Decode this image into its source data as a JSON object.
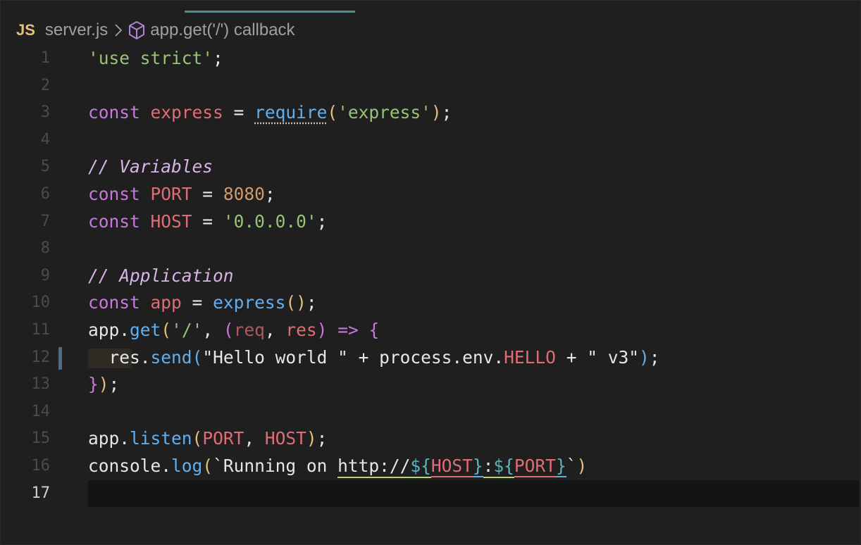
{
  "breadcrumb": {
    "lang_badge": "JS",
    "file": "server.js",
    "symbol": "app.get('/') callback"
  },
  "editor": {
    "current_line": 17,
    "lines": [
      {
        "n": "1",
        "tokens": [
          {
            "t": "'use strict'",
            "c": "str"
          },
          {
            "t": ";",
            "c": "punc"
          }
        ]
      },
      {
        "n": "2",
        "tokens": []
      },
      {
        "n": "3",
        "tokens": [
          {
            "t": "const",
            "c": "kw"
          },
          {
            "t": " ",
            "c": "plain"
          },
          {
            "t": "express",
            "c": "var"
          },
          {
            "t": " = ",
            "c": "punc"
          },
          {
            "t": "require",
            "c": "fn dotted"
          },
          {
            "t": "(",
            "c": "paren"
          },
          {
            "t": "'express'",
            "c": "str"
          },
          {
            "t": ")",
            "c": "paren"
          },
          {
            "t": ";",
            "c": "punc"
          }
        ]
      },
      {
        "n": "4",
        "tokens": []
      },
      {
        "n": "5",
        "tokens": [
          {
            "t": "// Variables",
            "c": "cmt"
          }
        ]
      },
      {
        "n": "6",
        "tokens": [
          {
            "t": "const",
            "c": "kw"
          },
          {
            "t": " ",
            "c": "plain"
          },
          {
            "t": "PORT",
            "c": "var"
          },
          {
            "t": " = ",
            "c": "punc"
          },
          {
            "t": "8080",
            "c": "num"
          },
          {
            "t": ";",
            "c": "punc"
          }
        ]
      },
      {
        "n": "7",
        "tokens": [
          {
            "t": "const",
            "c": "kw"
          },
          {
            "t": " ",
            "c": "plain"
          },
          {
            "t": "HOST",
            "c": "var"
          },
          {
            "t": " = ",
            "c": "punc"
          },
          {
            "t": "'0.0.0.0'",
            "c": "str"
          },
          {
            "t": ";",
            "c": "punc"
          }
        ]
      },
      {
        "n": "8",
        "tokens": []
      },
      {
        "n": "9",
        "tokens": [
          {
            "t": "// Application",
            "c": "cmt"
          }
        ]
      },
      {
        "n": "10",
        "tokens": [
          {
            "t": "const",
            "c": "kw"
          },
          {
            "t": " ",
            "c": "plain"
          },
          {
            "t": "app",
            "c": "var"
          },
          {
            "t": " = ",
            "c": "punc"
          },
          {
            "t": "express",
            "c": "fn"
          },
          {
            "t": "()",
            "c": "paren"
          },
          {
            "t": ";",
            "c": "punc"
          }
        ]
      },
      {
        "n": "11",
        "tokens": [
          {
            "t": "app",
            "c": "plain"
          },
          {
            "t": ".",
            "c": "punc"
          },
          {
            "t": "get",
            "c": "fn"
          },
          {
            "t": "(",
            "c": "paren"
          },
          {
            "t": "'/'",
            "c": "str"
          },
          {
            "t": ", ",
            "c": "punc"
          },
          {
            "t": "(",
            "c": "paren2"
          },
          {
            "t": "req",
            "c": "param"
          },
          {
            "t": ", ",
            "c": "punc"
          },
          {
            "t": "res",
            "c": "var"
          },
          {
            "t": ")",
            "c": "paren2"
          },
          {
            "t": " ",
            "c": "plain"
          },
          {
            "t": "=>",
            "c": "kw"
          },
          {
            "t": " ",
            "c": "plain"
          },
          {
            "t": "{",
            "c": "paren2"
          }
        ]
      },
      {
        "n": "12",
        "tokens": [
          {
            "t": "  ",
            "c": "plain"
          },
          {
            "t": "res",
            "c": "plain"
          },
          {
            "t": ".",
            "c": "punc"
          },
          {
            "t": "send",
            "c": "fn"
          },
          {
            "t": "(",
            "c": "fn"
          },
          {
            "t": "\"Hello world \"",
            "c": "dq"
          },
          {
            "t": " + ",
            "c": "punc"
          },
          {
            "t": "process",
            "c": "plain"
          },
          {
            "t": ".",
            "c": "punc"
          },
          {
            "t": "env",
            "c": "plain"
          },
          {
            "t": ".",
            "c": "punc"
          },
          {
            "t": "HELLO",
            "c": "var"
          },
          {
            "t": " + ",
            "c": "punc"
          },
          {
            "t": "\" v3\"",
            "c": "dq"
          },
          {
            "t": ")",
            "c": "fn"
          },
          {
            "t": ";",
            "c": "punc"
          }
        ]
      },
      {
        "n": "13",
        "tokens": [
          {
            "t": "}",
            "c": "paren2"
          },
          {
            "t": ")",
            "c": "paren"
          },
          {
            "t": ";",
            "c": "punc"
          }
        ]
      },
      {
        "n": "14",
        "tokens": []
      },
      {
        "n": "15",
        "tokens": [
          {
            "t": "app",
            "c": "plain"
          },
          {
            "t": ".",
            "c": "punc"
          },
          {
            "t": "listen",
            "c": "fn"
          },
          {
            "t": "(",
            "c": "paren"
          },
          {
            "t": "PORT",
            "c": "var"
          },
          {
            "t": ", ",
            "c": "punc"
          },
          {
            "t": "HOST",
            "c": "var"
          },
          {
            "t": ")",
            "c": "paren"
          },
          {
            "t": ";",
            "c": "punc"
          }
        ]
      },
      {
        "n": "16",
        "tokens": [
          {
            "t": "console",
            "c": "plain"
          },
          {
            "t": ".",
            "c": "punc"
          },
          {
            "t": "log",
            "c": "fn"
          },
          {
            "t": "(",
            "c": "paren"
          },
          {
            "t": "`Running on ",
            "c": "tmpl"
          },
          {
            "t": "http://",
            "c": "tmpl u-green"
          },
          {
            "t": "${",
            "c": "dollar u-green"
          },
          {
            "t": "HOST",
            "c": "var u-red"
          },
          {
            "t": "}",
            "c": "dollar u-blue"
          },
          {
            "t": ":",
            "c": "tmpl u-green"
          },
          {
            "t": "${",
            "c": "dollar u-green"
          },
          {
            "t": "PORT",
            "c": "var u-red"
          },
          {
            "t": "}",
            "c": "dollar u-blue"
          },
          {
            "t": "`",
            "c": "tmpl"
          },
          {
            "t": ")",
            "c": "paren"
          }
        ]
      },
      {
        "n": "17",
        "tokens": []
      }
    ]
  },
  "colors": {
    "background": "#1f1f1f",
    "keyword": "#c678dd",
    "variable": "#e06c75",
    "string": "#98c379",
    "number": "#d19a66",
    "function": "#61afef",
    "comment": "#d6b4e8"
  }
}
